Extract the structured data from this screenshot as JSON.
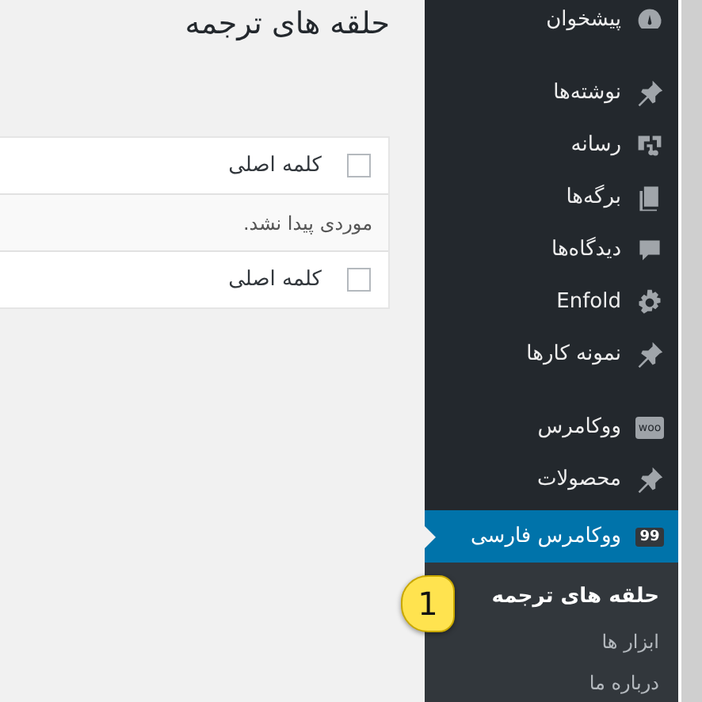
{
  "page_title": "حلقه های ترجمه",
  "table": {
    "header": {
      "label": "کلمه اصلی",
      "checked": false
    },
    "empty_message": "موردی پیدا نشد.",
    "footer": {
      "label": "کلمه اصلی",
      "checked": false
    }
  },
  "sidebar": {
    "groups": [
      [
        {
          "label": "پیشخوان",
          "kind": "dashboard",
          "selected": false
        }
      ],
      [
        {
          "label": "نوشته‌ها",
          "kind": "pin",
          "selected": false
        },
        {
          "label": "رسانه",
          "kind": "media",
          "selected": false
        },
        {
          "label": "برگه‌ها",
          "kind": "pages",
          "selected": false
        },
        {
          "label": "دیدگاه‌ها",
          "kind": "comments",
          "selected": false
        },
        {
          "label": "Enfold",
          "kind": "gear",
          "selected": false
        },
        {
          "label": "نمونه کارها",
          "kind": "pin",
          "selected": false
        }
      ],
      [
        {
          "label": "ووکامرس",
          "kind": "woo",
          "badge": "woo",
          "selected": false
        },
        {
          "label": "محصولات",
          "kind": "pin",
          "selected": false
        },
        {
          "label": "ووکامرس فارسی",
          "kind": "badge",
          "badge": "99",
          "selected": true
        }
      ]
    ],
    "submenu": [
      {
        "label": "حلقه های ترجمه",
        "selected": true
      },
      {
        "label": "ابزار ها",
        "selected": false
      },
      {
        "label": "درباره ما",
        "selected": false
      }
    ]
  },
  "callout": "1"
}
